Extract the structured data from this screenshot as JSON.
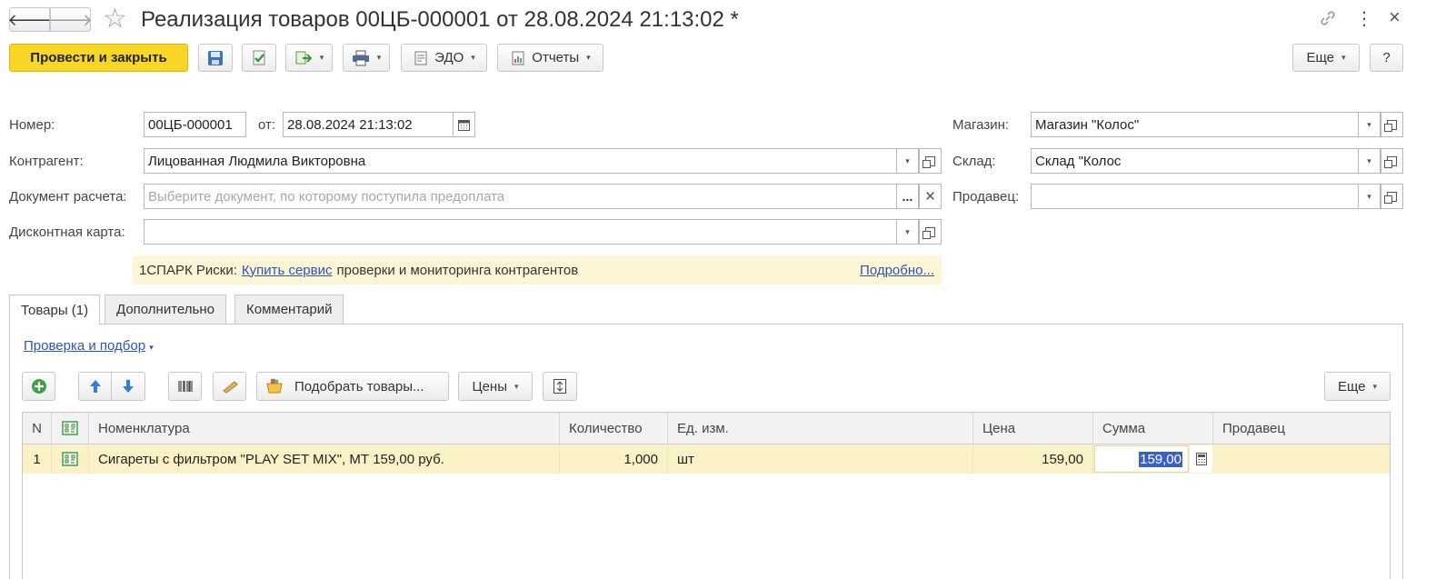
{
  "window": {
    "title": "Реализация товаров 00ЦБ-000001 от 28.08.2024 21:13:02 *",
    "nav_back": "🡐",
    "nav_forward": "🡒",
    "star": "☆",
    "link_icon": "🔗",
    "more_icon": "⋮",
    "close_icon": "×"
  },
  "toolbar": {
    "post_close": "Провести и закрыть",
    "edo": "ЭДО",
    "reports": "Отчеты",
    "more": "Еще",
    "help": "?"
  },
  "form": {
    "number_label": "Номер:",
    "number_value": "00ЦБ-000001",
    "from_label": "от:",
    "date_value": "28.08.2024 21:13:02",
    "counterparty_label": "Контрагент:",
    "counterparty_value": "Лицованная Людмила Викторовна",
    "doc_label": "Документ расчета:",
    "doc_placeholder": "Выберите документ, по которому поступила предоплата",
    "discount_label": "Дисконтная карта:",
    "discount_value": "",
    "store_label": "Магазин:",
    "store_value": "Магазин \"Колос\"",
    "warehouse_label": "Склад:",
    "warehouse_value": "Склад \"Колос",
    "seller_label": "Продавец:",
    "seller_value": ""
  },
  "banner": {
    "prefix": "1СПАРК Риски:",
    "link": "Купить сервис",
    "text": "проверки и мониторинга контрагентов",
    "more": "Подробно..."
  },
  "tabs": [
    {
      "label": "Товары (1)"
    },
    {
      "label": "Дополнительно"
    },
    {
      "label": "Комментарий"
    }
  ],
  "goods": {
    "check_link": "Проверка и подбор",
    "pick_button": "Подобрать товары...",
    "prices_button": "Цены",
    "more_button": "Еще",
    "columns": [
      "N",
      "",
      "Номенклатура",
      "Количество",
      "Ед. изм.",
      "Цена",
      "Сумма",
      "Продавец"
    ],
    "rows": [
      {
        "n": "1",
        "name": "Сигареты с фильтром \"PLAY SET MIX\", МТ 159,00 руб.",
        "qty": "1,000",
        "unit": "шт",
        "price": "159,00",
        "sum": "159,00",
        "seller": ""
      }
    ]
  },
  "colors": {
    "accent": "#f7d626",
    "link": "#2b55b8",
    "row_selected": "#fbf1c7",
    "banner_bg": "#fdf6d6",
    "selection": "#3a5fcd"
  }
}
